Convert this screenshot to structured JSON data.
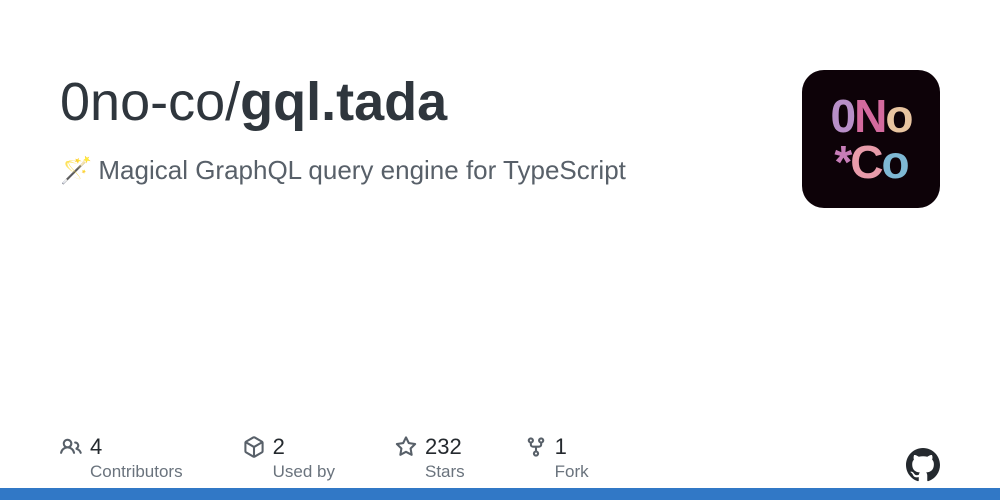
{
  "repo": {
    "owner": "0no-co",
    "name": "gql.tada",
    "separator": "/"
  },
  "description": {
    "emoji": "🪄",
    "text": "Magical GraphQL query engine for TypeScript"
  },
  "logo": {
    "line1": {
      "zero": "0",
      "n": "N",
      "o": "o"
    },
    "line2": {
      "star": "*",
      "c": "C",
      "o": "o"
    }
  },
  "stats": {
    "contributors": {
      "value": "4",
      "label": "Contributors"
    },
    "usedby": {
      "value": "2",
      "label": "Used by"
    },
    "stars": {
      "value": "232",
      "label": "Stars"
    },
    "forks": {
      "value": "1",
      "label": "Fork"
    }
  },
  "colors": {
    "languageBar": "#3178c6"
  }
}
